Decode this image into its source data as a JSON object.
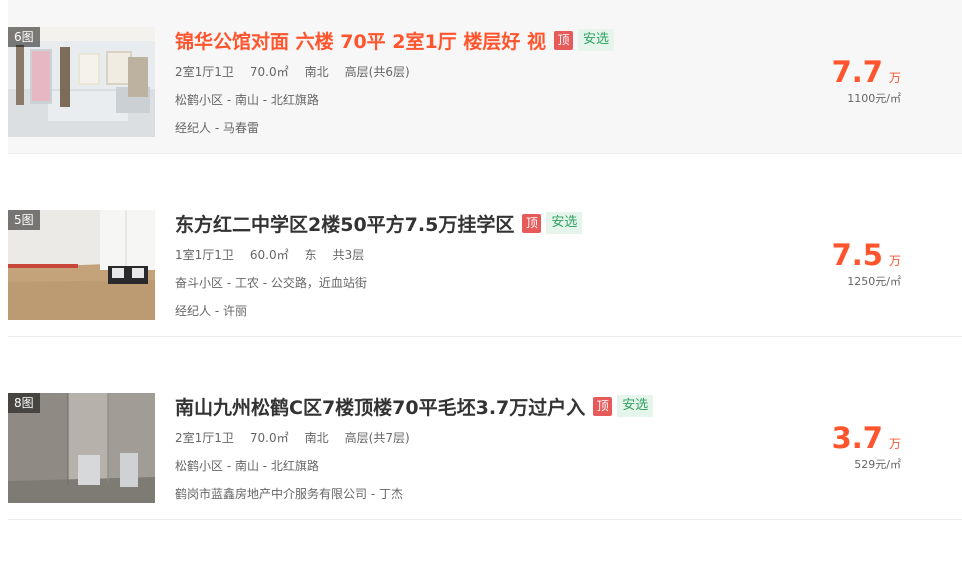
{
  "listings": [
    {
      "pic_count": "6图",
      "title": "锦华公馆对面 六楼 70平 2室1厅 楼层好 视",
      "tag_top": "顶",
      "tag_safe": "安选",
      "layout": "2室1厅1卫",
      "area": "70.0㎡",
      "orientation": "南北",
      "floor": "高层(共6层)",
      "address": "松鹤小区 - 南山 - 北红旗路",
      "agent": "经纪人 - 马春雷",
      "price": "7.7",
      "price_unit": "万",
      "unit_price": "1100元/㎡",
      "hovered": true
    },
    {
      "pic_count": "5图",
      "title": "东方红二中学区2楼50平方7.5万挂学区",
      "tag_top": "顶",
      "tag_safe": "安选",
      "layout": "1室1厅1卫",
      "area": "60.0㎡",
      "orientation": "东",
      "floor": "共3层",
      "address": "奋斗小区 - 工农 - 公交路，近血站街",
      "agent": "经纪人 - 许丽",
      "price": "7.5",
      "price_unit": "万",
      "unit_price": "1250元/㎡",
      "hovered": false
    },
    {
      "pic_count": "8图",
      "title": "南山九州松鹤C区7楼顶楼70平毛坯3.7万过户入",
      "tag_top": "顶",
      "tag_safe": "安选",
      "layout": "2室1厅1卫",
      "area": "70.0㎡",
      "orientation": "南北",
      "floor": "高层(共7层)",
      "address": "松鹤小区 - 南山 - 北红旗路",
      "agent": "鹤岗市蓝鑫房地产中介服务有限公司 - 丁杰",
      "price": "3.7",
      "price_unit": "万",
      "unit_price": "529元/㎡",
      "hovered": false
    }
  ],
  "colors": {
    "accent": "#ff552e",
    "tag_top": "#e65a5a",
    "tag_safe_text": "#2fa160",
    "tag_safe_bg": "#e6f5ec"
  }
}
